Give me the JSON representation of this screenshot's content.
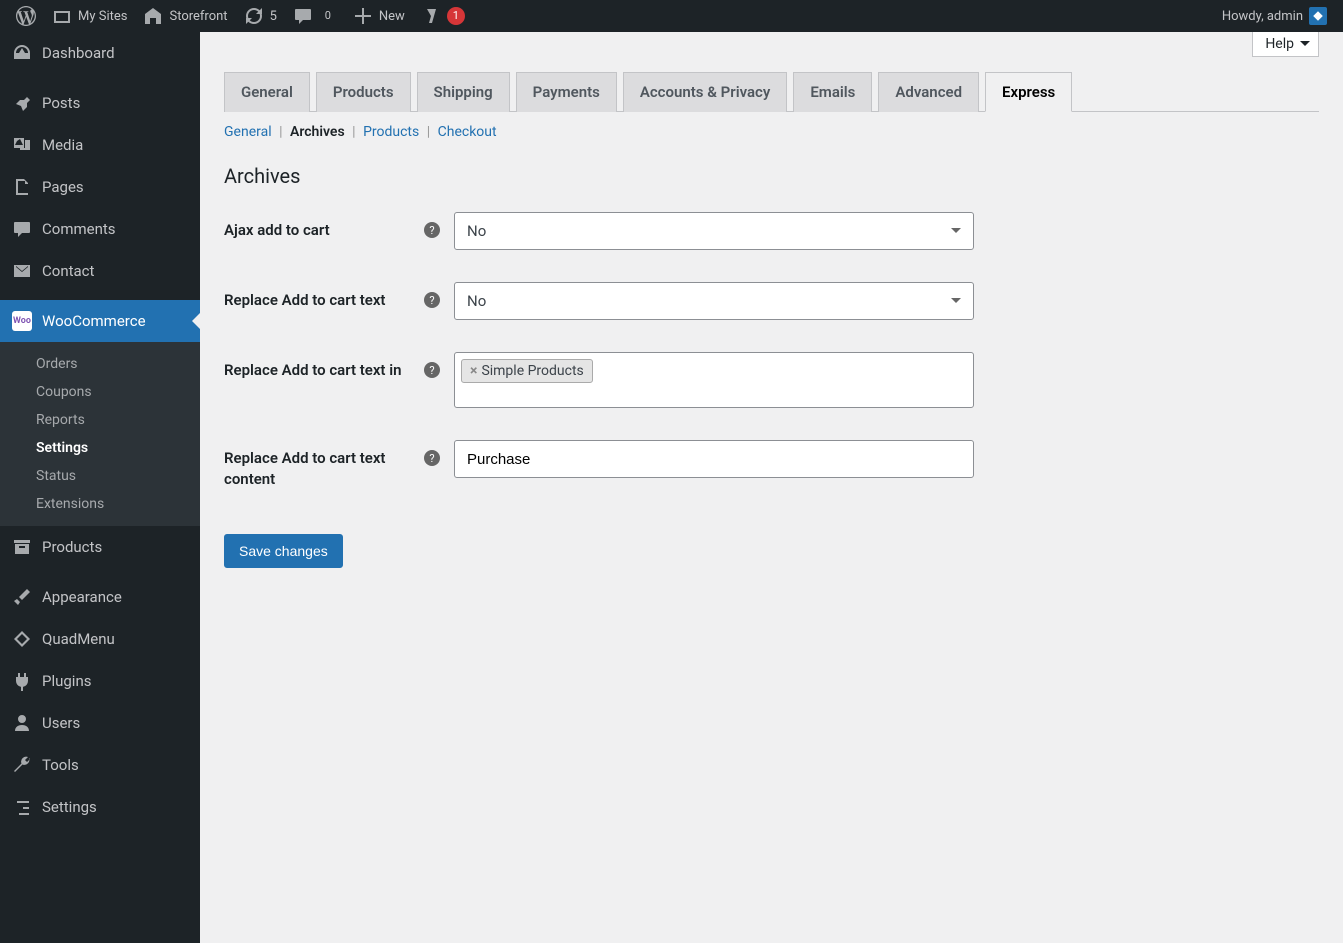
{
  "adminbar": {
    "my_sites": "My Sites",
    "site_name": "Storefront",
    "updates_count": "5",
    "comments_count": "0",
    "new_label": "New",
    "yoast_count": "1",
    "howdy": "Howdy, admin"
  },
  "sidebar": {
    "dashboard": "Dashboard",
    "posts": "Posts",
    "media": "Media",
    "pages": "Pages",
    "comments": "Comments",
    "contact": "Contact",
    "woocommerce": "WooCommerce",
    "woo_sub": {
      "orders": "Orders",
      "coupons": "Coupons",
      "reports": "Reports",
      "settings": "Settings",
      "status": "Status",
      "extensions": "Extensions"
    },
    "products": "Products",
    "appearance": "Appearance",
    "quadmenu": "QuadMenu",
    "plugins": "Plugins",
    "users": "Users",
    "tools": "Tools",
    "settings": "Settings"
  },
  "content": {
    "help": "Help",
    "tabs": {
      "general": "General",
      "products": "Products",
      "shipping": "Shipping",
      "payments": "Payments",
      "accounts": "Accounts & Privacy",
      "emails": "Emails",
      "advanced": "Advanced",
      "express": "Express"
    },
    "subtabs": {
      "general": "General",
      "archives": "Archives",
      "products": "Products",
      "checkout": "Checkout"
    },
    "heading": "Archives",
    "fields": {
      "ajax_label": "Ajax add to cart",
      "ajax_value": "No",
      "replace_label": "Replace Add to cart text",
      "replace_value": "No",
      "replace_in_label": "Replace Add to cart text in",
      "replace_in_chip": "Simple Products",
      "content_label": "Replace Add to cart text content",
      "content_value": "Purchase"
    },
    "save": "Save changes"
  }
}
